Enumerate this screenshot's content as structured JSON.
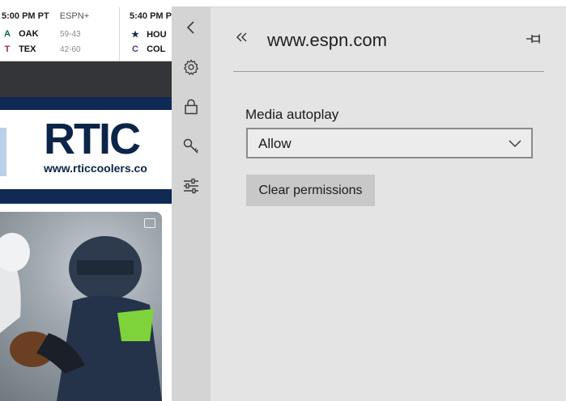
{
  "background_page": {
    "scoreboard": [
      {
        "time": "5:00 PM PT",
        "network": "ESPN+",
        "teams": [
          {
            "abbr": "OAK",
            "record": "59-43"
          },
          {
            "abbr": "TEX",
            "record": "42-60"
          }
        ]
      },
      {
        "time": "5:40 PM P",
        "network": "",
        "teams": [
          {
            "abbr": "HOU",
            "record": ""
          },
          {
            "abbr": "COL",
            "record": ""
          }
        ]
      }
    ],
    "ad": {
      "logo_text": "RTIC",
      "url": "www.rticcoolers.co"
    }
  },
  "side_panel": {
    "rail": [
      {
        "icon": "back-icon"
      },
      {
        "icon": "gear-icon"
      },
      {
        "icon": "lock-icon"
      },
      {
        "icon": "key-icon"
      },
      {
        "icon": "sliders-icon",
        "active": true
      }
    ],
    "header": {
      "site": "www.espn.com"
    },
    "media_autoplay": {
      "label": "Media autoplay",
      "selected": "Allow"
    },
    "clear_permissions_label": "Clear permissions"
  },
  "colors": {
    "rail_bg": "#d4d4d4",
    "panel_bg": "#e4e4e4",
    "accent": "#1a73c8",
    "button_bg": "#c8c8c8"
  }
}
